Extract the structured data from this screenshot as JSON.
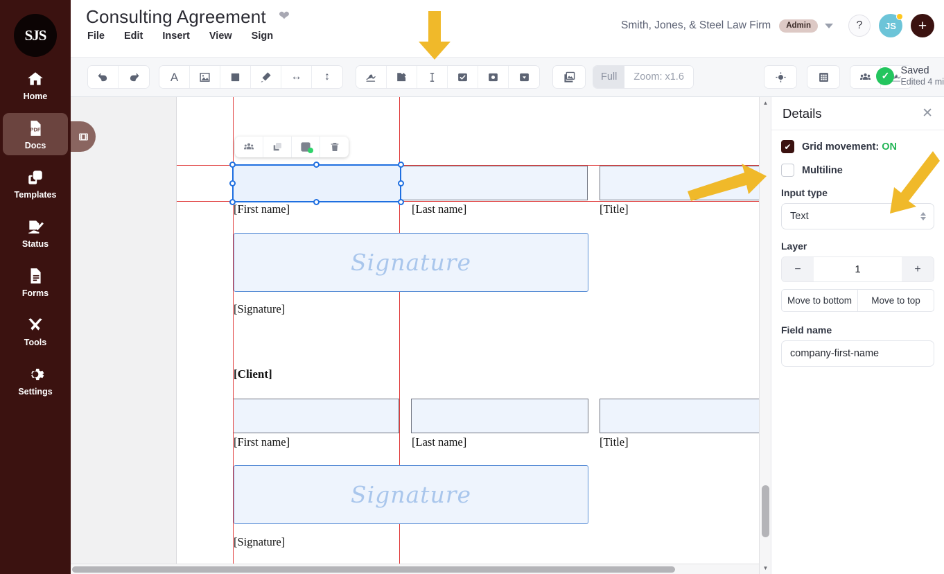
{
  "brand": {
    "logo_text": "SJS",
    "rail_bg": "#3b1210",
    "accent": "#3b1210"
  },
  "header": {
    "doc_title": "Consulting Agreement",
    "favorite_icon": "heart-icon",
    "menu": [
      "File",
      "Edit",
      "Insert",
      "View",
      "Sign"
    ],
    "firm_name": "Smith, Jones, & Steel Law Firm",
    "role_badge": "Admin",
    "help_label": "?",
    "avatar_initials": "JS",
    "add_label": "+"
  },
  "sidebar": {
    "items": [
      {
        "label": "Home",
        "icon": "home-icon",
        "active": false
      },
      {
        "label": "Docs",
        "icon": "pdf-doc-icon",
        "active": true
      },
      {
        "label": "Templates",
        "icon": "copy-stack-icon",
        "active": false
      },
      {
        "label": "Status",
        "icon": "sign-pen-icon",
        "active": false
      },
      {
        "label": "Forms",
        "icon": "form-lines-icon",
        "active": false
      },
      {
        "label": "Tools",
        "icon": "wrench-screwdriver-icon",
        "active": false
      },
      {
        "label": "Settings",
        "icon": "gear-icon",
        "active": false
      }
    ]
  },
  "toolbar": {
    "history": [
      {
        "name": "undo-icon",
        "glyph": "↺"
      },
      {
        "name": "redo-icon",
        "glyph": "↻"
      }
    ],
    "insert": [
      {
        "name": "text-A-icon",
        "glyph": "A"
      },
      {
        "name": "image-icon",
        "glyph": ""
      },
      {
        "name": "filled-square-icon",
        "glyph": ""
      },
      {
        "name": "highlighter-pen-icon",
        "glyph": ""
      },
      {
        "name": "arrow-horizontal-icon",
        "glyph": "↔"
      },
      {
        "name": "arrow-vertical-icon",
        "glyph": "↕"
      }
    ],
    "fields": [
      {
        "name": "signature-field-icon",
        "glyph": ""
      },
      {
        "name": "initials-field-icon",
        "glyph": ""
      },
      {
        "name": "text-field-icon",
        "glyph": ""
      },
      {
        "name": "checkbox-field-icon",
        "glyph": ""
      },
      {
        "name": "radio-field-icon",
        "glyph": ""
      },
      {
        "name": "dropdown-field-icon",
        "glyph": ""
      }
    ],
    "media": [
      {
        "name": "stamp-image-icon",
        "glyph": ""
      }
    ],
    "zoom": {
      "full_label": "Full",
      "level_label": "Zoom: x1.6"
    },
    "view": [
      {
        "name": "target-focus-icon",
        "glyph": ""
      }
    ],
    "grid": [
      {
        "name": "grid-icon",
        "glyph": ""
      }
    ],
    "share": [
      {
        "name": "recipients-icon",
        "glyph": ""
      },
      {
        "name": "request-signature-icon",
        "glyph": ""
      }
    ],
    "save_status": {
      "title": "Saved",
      "subtitle": "Edited 4 mi",
      "check_icon": "check-circle-icon",
      "color": "#23c55e"
    }
  },
  "canvas": {
    "pages_toggle_icon": "pages-filmstrip-icon",
    "selected_field": {
      "field_tools": [
        {
          "name": "assign-recipient-icon"
        },
        {
          "name": "duplicate-icon"
        },
        {
          "name": "field-settings-icon",
          "badge": "green-dot"
        },
        {
          "name": "delete-icon"
        }
      ]
    },
    "document": {
      "rows": [
        {
          "fields": [
            {
              "label": "[First name]",
              "selected": true,
              "type": "text"
            },
            {
              "label": "[Last name]",
              "selected": false,
              "type": "text"
            },
            {
              "label": "[Title]",
              "selected": false,
              "type": "text"
            }
          ]
        },
        {
          "fields": [
            {
              "label": "[Signature]",
              "selected": false,
              "type": "signature",
              "placeholder": "Signature"
            }
          ]
        },
        {
          "heading": "[Client]"
        },
        {
          "fields": [
            {
              "label": "[First name]",
              "selected": false,
              "type": "text"
            },
            {
              "label": "[Last name]",
              "selected": false,
              "type": "text"
            },
            {
              "label": "[Title]",
              "selected": false,
              "type": "text"
            }
          ]
        },
        {
          "fields": [
            {
              "label": "[Signature]",
              "selected": false,
              "type": "signature",
              "placeholder": "Signature"
            }
          ]
        }
      ],
      "labels": {
        "first_name": "[First name]",
        "last_name": "[Last name]",
        "title": "[Title]",
        "signature": "[Signature]",
        "client_heading": "[Client]",
        "signature_placeholder": "Signature"
      }
    }
  },
  "details": {
    "title": "Details",
    "close_icon": "close-icon",
    "grid_movement": {
      "label": "Grid movement:",
      "value": "ON",
      "checked": true
    },
    "multiline": {
      "label": "Multiline",
      "checked": false
    },
    "input_type": {
      "label": "Input type",
      "value": "Text"
    },
    "layer": {
      "label": "Layer",
      "value": "1",
      "minus": "−",
      "plus": "+",
      "move_bottom": "Move to bottom",
      "move_top": "Move to top"
    },
    "field_name": {
      "label": "Field name",
      "value": "company-first-name"
    }
  },
  "annotations": {
    "arrow_color": "#f0b92a",
    "arrows": [
      {
        "name": "arrow-pointing-text-field-tool",
        "direction": "down"
      },
      {
        "name": "arrow-pointing-multiline-checkbox",
        "direction": "right"
      },
      {
        "name": "arrow-pointing-input-type-select",
        "direction": "down-left"
      }
    ]
  }
}
